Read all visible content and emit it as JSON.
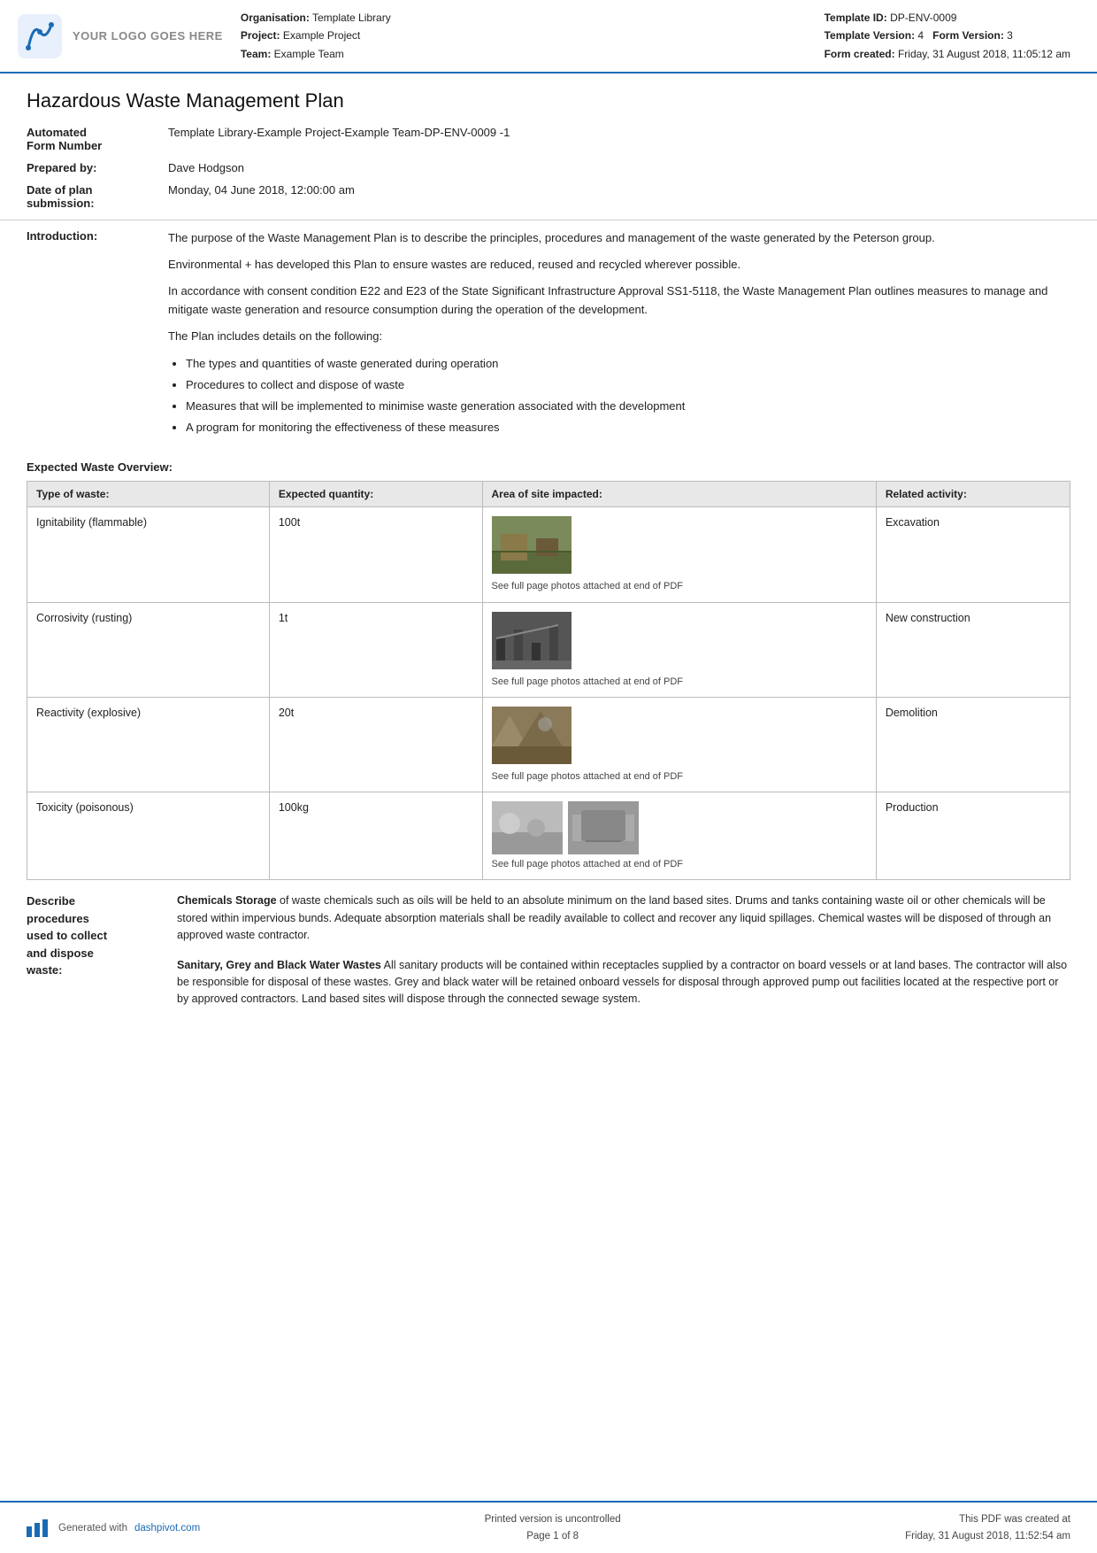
{
  "header": {
    "logo_text": "YOUR LOGO GOES HERE",
    "org_label": "Organisation:",
    "org_value": "Template Library",
    "project_label": "Project:",
    "project_value": "Example Project",
    "team_label": "Team:",
    "team_value": "Example Team",
    "template_id_label": "Template ID:",
    "template_id_value": "DP-ENV-0009",
    "template_version_label": "Template Version:",
    "template_version_value": "4",
    "form_version_label": "Form Version:",
    "form_version_value": "3",
    "form_created_label": "Form created:",
    "form_created_value": "Friday, 31 August 2018, 11:05:12 am"
  },
  "document": {
    "title": "Hazardous Waste Management Plan",
    "form_number_label": "Automated\nForm Number",
    "form_number_value": "Template Library-Example Project-Example Team-DP-ENV-0009   -1",
    "prepared_by_label": "Prepared by:",
    "prepared_by_value": "Dave Hodgson",
    "date_plan_label": "Date of plan\nsubmission:",
    "date_plan_value": "Monday, 04 June 2018, 12:00:00 am",
    "introduction_label": "Introduction:",
    "intro_p1": "The purpose of the Waste Management Plan is to describe the principles, procedures and management of the waste generated by the Peterson group.",
    "intro_p2": "Environmental + has developed this Plan to ensure wastes are reduced, reused and recycled wherever possible.",
    "intro_p3": "In accordance with consent condition E22 and E23 of the State Significant Infrastructure Approval SS1-5118, the Waste Management Plan outlines measures to manage and mitigate waste generation and resource consumption during the operation of the development.",
    "intro_p4": "The Plan includes details on the following:",
    "bullet_items": [
      "The types and quantities of waste generated during operation",
      "Procedures to collect and dispose of waste",
      "Measures that will be implemented to minimise waste generation associated with the development",
      "A program for monitoring the effectiveness of these measures"
    ]
  },
  "waste_overview": {
    "heading": "Expected Waste Overview:",
    "columns": [
      "Type of waste:",
      "Expected quantity:",
      "Area of site impacted:",
      "Related activity:"
    ],
    "rows": [
      {
        "type": "Ignitability (flammable)",
        "quantity": "100t",
        "photo_caption": "See full page photos attached at end of PDF",
        "activity": "Excavation",
        "photo_class": "excavation"
      },
      {
        "type": "Corrosivity (rusting)",
        "quantity": "1t",
        "photo_caption": "See full page photos attached at end of PDF",
        "activity": "New construction",
        "photo_class": "construction"
      },
      {
        "type": "Reactivity (explosive)",
        "quantity": "20t",
        "photo_caption": "See full page photos attached at end of PDF",
        "activity": "Demolition",
        "photo_class": "demolition"
      },
      {
        "type": "Toxicity (poisonous)",
        "quantity": "100kg",
        "photo_caption": "See full page photos attached at end of PDF",
        "activity": "Production",
        "photo_class": "production",
        "two_photos": true
      }
    ]
  },
  "procedures": {
    "label": "Describe\nprocedures\nused to collect\nand dispose\nwaste:",
    "p1_bold": "Chemicals Storage",
    "p1_text": " of waste chemicals such as oils will be held to an absolute minimum on the land based sites. Drums and tanks containing waste oil or other chemicals will be stored within impervious bunds. Adequate absorption materials shall be readily available to collect and recover any liquid spillages. Chemical wastes will be disposed of through an approved waste contractor.",
    "p2_bold": "Sanitary, Grey and Black Water Wastes",
    "p2_text": " All sanitary products will be contained within receptacles supplied by a contractor on board vessels or at land bases. The contractor will also be responsible for disposal of these wastes. Grey and black water will be retained onboard vessels for disposal through approved pump out facilities located at the respective port or by approved contractors. Land based sites will dispose through the connected sewage system."
  },
  "footer": {
    "generated_text": "Generated with",
    "dashpivot_link": "dashpivot.com",
    "uncontrolled_text": "Printed version is uncontrolled",
    "page_label": "Page 1 of 8",
    "pdf_created_text": "This PDF was created at",
    "pdf_created_date": "Friday, 31 August 2018, 11:52:54 am"
  }
}
